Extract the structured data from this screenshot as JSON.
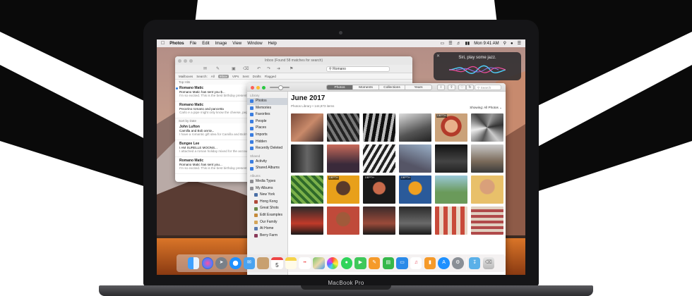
{
  "laptop": {
    "brand": "MacBook Pro"
  },
  "menubar": {
    "app_name": "Photos",
    "menus": [
      "File",
      "Edit",
      "Image",
      "View",
      "Window",
      "Help"
    ],
    "clock": "Mon 9:41 AM"
  },
  "siri": {
    "prompt": "Siri, play some jazz."
  },
  "mail": {
    "window_title": "Inbox (Found 58 matches for search)",
    "search_value": "Romano",
    "filter_label": "Search:",
    "filters": [
      "All",
      "Inbox",
      "VIPs",
      "Sent",
      "Drafts",
      "Flagged"
    ],
    "active_filter": "Inbox",
    "mailboxes_label": "Mailboxes",
    "top_hits_label": "Top Hits",
    "sort_label": "Sort by Date",
    "messages": [
      {
        "from": "Romano Matic",
        "time": "9:28AM",
        "subject": "Romano Matic has sent you $...",
        "preview": "I'm so excited. This is the best birthday present ever! Looking forward to finally...",
        "box": "Inbox - iCloud",
        "unread": true
      },
      {
        "from": "Romano Matic",
        "time": "June 3",
        "subject": "Pecorino romano and pancetta",
        "preview": "Carlo e a pipe might only know the cheese, pepper, and spaghetti.",
        "box": "Inbox - iCloud",
        "unread": false
      },
      {
        "from": "John Lufton",
        "time": "9:41AM",
        "subject": "Camilla and Bob anniv...",
        "preview": "I have a romantic gift idea for Camilla and Bob's anniversary. Let me know...",
        "box": "Inbox - iCloud",
        "unread": false
      },
      {
        "from": "Bungee Lee",
        "time": "9:32AM",
        "subject": "I AM SURELLE MOONS...",
        "preview": "I attached a roman holiday mixed for the account. Can you take a look?",
        "box": "Inbox - iCloud",
        "unread": false
      },
      {
        "from": "Romano Matic",
        "time": "9:28AM",
        "subject": "Romano Matic has sent you...",
        "preview": "I'm so excited. This is the best birthday present ever! Looking forward to...",
        "box": "Inbox - iCloud",
        "unread": false
      }
    ]
  },
  "photos": {
    "tabs": [
      "Photos",
      "Moments",
      "Collections",
      "Years"
    ],
    "selected_tab": "Photos",
    "search_placeholder": "Search",
    "date_heading": "June 2017",
    "library_summary": "Photos Library • 144,873 items",
    "showing_label": "Showing: All Photos",
    "depth_badge": "DEPTH",
    "sidebar": {
      "library_header": "Library",
      "library_items": [
        "Photos",
        "Memories",
        "Favorites",
        "People",
        "Places",
        "Imports",
        "Hidden",
        "Recently Deleted"
      ],
      "shared_header": "Shared",
      "shared_items": [
        "Activity",
        "Shared Albums"
      ],
      "albums_header": "Albums",
      "album_groups": [
        "Media Types",
        "My Albums"
      ],
      "my_albums": [
        "New York",
        "Hong Kong",
        "Great Shots",
        "Edit Examples",
        "Our Family",
        "At Home",
        "Berry Farm"
      ]
    }
  },
  "dock": {
    "calendar_day": "5",
    "apps": [
      "finder-icon",
      "siri-icon",
      "launchpad-icon",
      "safari-icon",
      "mail-icon",
      "contacts-icon",
      "calendar-icon",
      "notes-icon",
      "reminders-icon",
      "maps-icon",
      "photos-icon",
      "messages-icon",
      "facetime-icon",
      "pages-icon",
      "numbers-icon",
      "keynote-icon",
      "music-icon",
      "books-icon",
      "app-store-icon",
      "settings-icon",
      "downloads-icon",
      "trash-icon"
    ]
  },
  "colors": {
    "accent": "#3a7de0",
    "traffic_red": "#fc5f57",
    "traffic_yellow": "#fdbc2e",
    "traffic_green": "#28c840"
  }
}
